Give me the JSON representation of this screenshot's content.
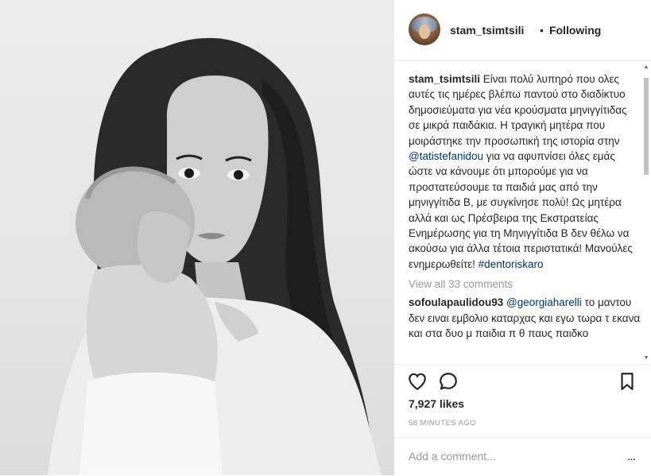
{
  "header": {
    "username": "stam_tsimtsili",
    "separator": "•",
    "follow_status": "Following"
  },
  "caption": {
    "username": "stam_tsimtsili",
    "text_part1": " Είναι πολύ λυπηρό που ολες αυτές τις ημέρες βλέπω παντού στο διαδίκτυο δημοσιεύματα για νέα κρούσματα μηνιγγίτιδας σε μικρά παιδάκια. Η τραγική μητέρα που μοιράστηκε την προσωπική της ιστορία στην ",
    "mention": "@tatistefanidou",
    "text_part2": " για να αφυπνίσει όλες εμάς ώστε να κάνουμε ότι μπορούμε για να προστατεύσουμε τα παιδιά μας από την μηνιγγίτιδα Β, με συγκίνησε πολύ! Ως μητέρα αλλά και ως Πρέσβειρα της Εκστρατείας Ενημέρωσης για τη Μηνιγγίτιδα Β δεν θέλω να ακούσω για άλλα τέτοια περιστατικά! Μανούλες ενημερωθείτε! ",
    "hashtag": "#dentoriskaro"
  },
  "view_all": "View all 33 comments",
  "comment": {
    "username": "sofoulapaulidou93",
    "mention": "@georgiaharelli",
    "text": " το μαντου δεν ειναι εμβολιο καταρχας και εγω τωρα τ εκανα και στα δυο μ παιδια π θ παυς παιδκο"
  },
  "likes": "7,927 likes",
  "timestamp": "58 MINUTES AGO",
  "add_comment_placeholder": "Add a comment...",
  "more_icon": "...",
  "icons": [
    "heart-icon",
    "comment-icon",
    "bookmark-icon",
    "more-icon",
    "avatar"
  ]
}
